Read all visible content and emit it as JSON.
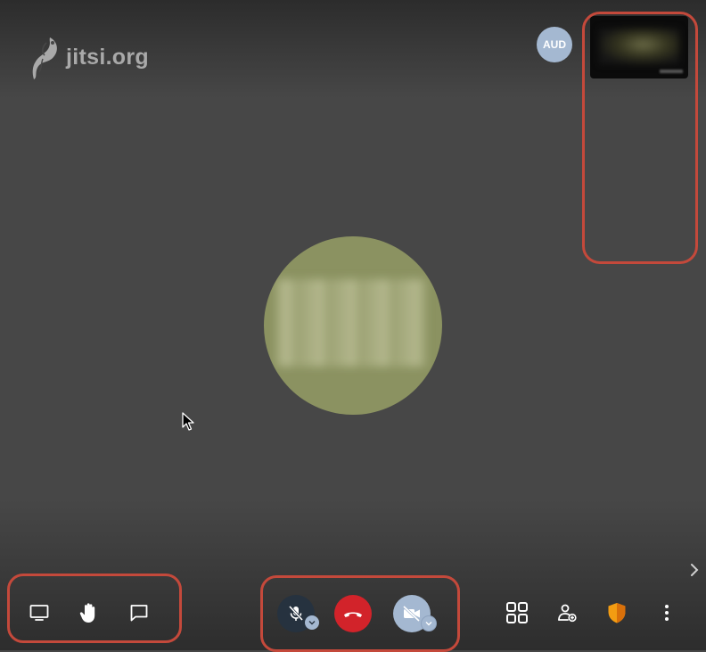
{
  "watermark": {
    "text": "jitsi.org"
  },
  "participant_badge": {
    "initials": "AUD"
  },
  "colors": {
    "background": "#474747",
    "highlight_outline": "#c4493b",
    "hangup": "#d2232a",
    "avatar_green": "#8b9261",
    "badge_blue": "#a4b8d1",
    "shield_orange": "#f39c12"
  },
  "toolbar": {
    "left": [
      {
        "icon": "screen-share-icon"
      },
      {
        "icon": "raise-hand-icon"
      },
      {
        "icon": "chat-icon"
      }
    ],
    "center": [
      {
        "icon": "microphone-muted-icon",
        "state": "muted"
      },
      {
        "icon": "hangup-icon"
      },
      {
        "icon": "camera-off-icon",
        "state": "off"
      }
    ],
    "right": [
      {
        "icon": "tile-view-icon"
      },
      {
        "icon": "invite-people-icon"
      },
      {
        "icon": "security-shield-icon"
      },
      {
        "icon": "more-options-icon"
      }
    ]
  },
  "filmstrip": {
    "toggle_icon": "chevron-right-icon"
  }
}
